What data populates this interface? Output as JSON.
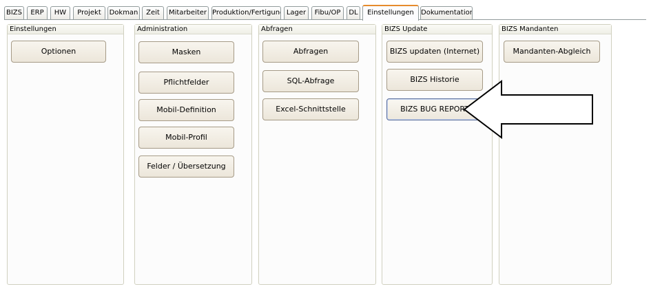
{
  "tabs": [
    {
      "label": "BIZS",
      "active": false
    },
    {
      "label": "ERP",
      "active": false
    },
    {
      "label": "HW",
      "active": false
    },
    {
      "label": "Projekt",
      "active": false
    },
    {
      "label": "Dokman",
      "active": false
    },
    {
      "label": "Zeit",
      "active": false
    },
    {
      "label": "Mitarbeiter",
      "active": false
    },
    {
      "label": "Produktion/Fertigung",
      "active": false
    },
    {
      "label": "Lager",
      "active": false
    },
    {
      "label": "Fibu/OP",
      "active": false
    },
    {
      "label": "DL",
      "active": false
    },
    {
      "label": "Einstellungen",
      "active": true
    },
    {
      "label": "Dokumentation",
      "active": false
    }
  ],
  "groups": {
    "einstellungen": {
      "title": "Einstellungen",
      "buttons": [
        "Optionen"
      ]
    },
    "administration": {
      "title": "Administration",
      "buttons": [
        "Masken",
        "Pflichtfelder",
        "Mobil-Definition",
        "Mobil-Profil",
        "Felder / Übersetzung"
      ]
    },
    "abfragen": {
      "title": "Abfragen",
      "buttons": [
        "Abfragen",
        "SQL-Abfrage",
        "Excel-Schnittstelle"
      ]
    },
    "bizs_update": {
      "title": "BIZS Update",
      "buttons": [
        "BIZS updaten (Internet)",
        "BIZS Historie",
        "BIZS BUG REPORT"
      ]
    },
    "bizs_mandanten": {
      "title": "BIZS Mandanten",
      "buttons": [
        "Mandanten-Abgleich"
      ]
    }
  },
  "colors": {
    "active_tab_accent": "#e68b2c",
    "tab_border": "#919b9c",
    "button_border": "#a59a86",
    "highlight_border": "#5a6e9c",
    "arrow_fill": "#ffffff",
    "arrow_stroke": "#000000"
  },
  "annotation": {
    "icon": "pointer-arrow-icon",
    "points_to": "BIZS BUG REPORT"
  }
}
